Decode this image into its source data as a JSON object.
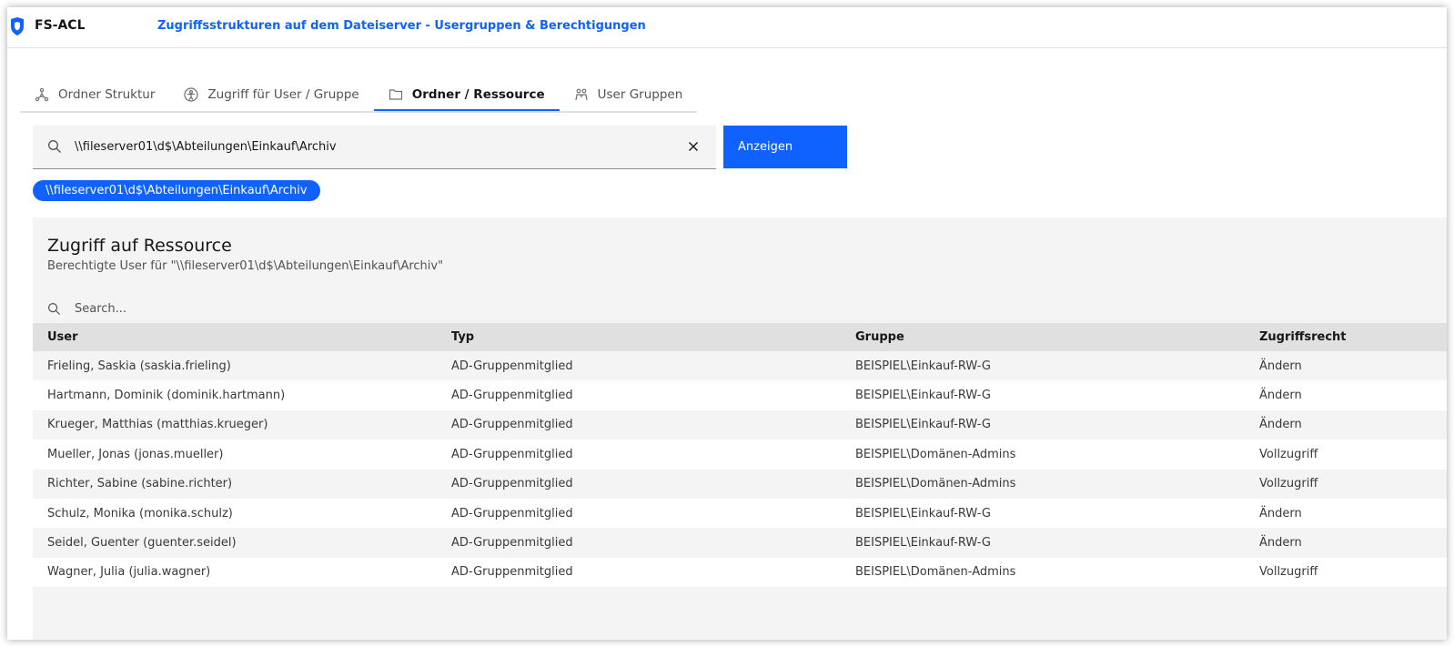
{
  "header": {
    "app_name": "FS-ACL",
    "title": "Zugriffsstrukturen auf dem Dateiserver - Usergruppen & Berechtigungen"
  },
  "tabs": [
    {
      "label": "Ordner Struktur",
      "icon": "tree-icon",
      "active": false
    },
    {
      "label": "Zugriff für User / Gruppe",
      "icon": "user-access-icon",
      "active": false
    },
    {
      "label": "Ordner / Ressource",
      "icon": "folder-icon",
      "active": true
    },
    {
      "label": "User Gruppen",
      "icon": "user-group-icon",
      "active": false
    }
  ],
  "search": {
    "value": "\\\\fileserver01\\d$\\Abteilungen\\Einkauf\\Archiv",
    "button_label": "Anzeigen"
  },
  "path_tag": "\\\\fileserver01\\d$\\Abteilungen\\Einkauf\\Archiv",
  "table": {
    "title": "Zugriff auf Ressource",
    "description": "Berechtigte User für \"\\\\fileserver01\\d$\\Abteilungen\\Einkauf\\Archiv\"",
    "search_placeholder": "Search...",
    "columns": [
      "User",
      "Typ",
      "Gruppe",
      "Zugriffsrecht"
    ],
    "rows": [
      [
        "Frieling, Saskia (saskia.frieling)",
        "AD-Gruppenmitglied",
        "BEISPIEL\\Einkauf-RW-G",
        "Ändern"
      ],
      [
        "Hartmann, Dominik (dominik.hartmann)",
        "AD-Gruppenmitglied",
        "BEISPIEL\\Einkauf-RW-G",
        "Ändern"
      ],
      [
        "Krueger, Matthias (matthias.krueger)",
        "AD-Gruppenmitglied",
        "BEISPIEL\\Einkauf-RW-G",
        "Ändern"
      ],
      [
        "Mueller, Jonas (jonas.mueller)",
        "AD-Gruppenmitglied",
        "BEISPIEL\\Domänen-Admins",
        "Vollzugriff"
      ],
      [
        "Richter, Sabine (sabine.richter)",
        "AD-Gruppenmitglied",
        "BEISPIEL\\Domänen-Admins",
        "Vollzugriff"
      ],
      [
        "Schulz, Monika (monika.schulz)",
        "AD-Gruppenmitglied",
        "BEISPIEL\\Einkauf-RW-G",
        "Ändern"
      ],
      [
        "Seidel, Guenter (guenter.seidel)",
        "AD-Gruppenmitglied",
        "BEISPIEL\\Einkauf-RW-G",
        "Ändern"
      ],
      [
        "Wagner, Julia (julia.wagner)",
        "AD-Gruppenmitglied",
        "BEISPIEL\\Domänen-Admins",
        "Vollzugriff"
      ]
    ]
  },
  "colors": {
    "accent": "#0f62fe",
    "header_bg": "#e0e0e0",
    "panel_bg": "#f4f4f4"
  }
}
